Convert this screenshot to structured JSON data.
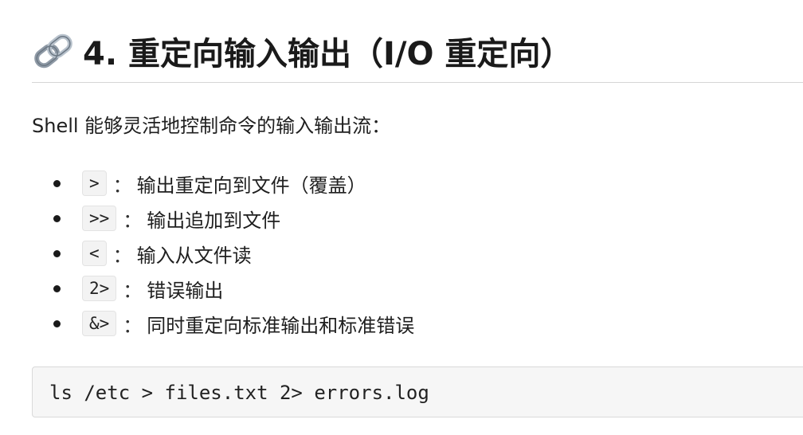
{
  "section": {
    "heading_icon": "link-icon",
    "title": "4. 重定向输入输出（I/O 重定向）",
    "intro": "Shell 能够灵活地控制命令的输入输出流："
  },
  "operators": [
    {
      "symbol": ">",
      "separator": "：",
      "description": "输出重定向到文件（覆盖）"
    },
    {
      "symbol": ">>",
      "separator": "：",
      "description": "输出追加到文件"
    },
    {
      "symbol": "<",
      "separator": "：",
      "description": "输入从文件读"
    },
    {
      "symbol": "2>",
      "separator": "：",
      "description": "错误输出"
    },
    {
      "symbol": "&>",
      "separator": "：",
      "description": "同时重定向标准输出和标准错误"
    }
  ],
  "example": {
    "command": "ls /etc > files.txt 2> errors.log"
  }
}
